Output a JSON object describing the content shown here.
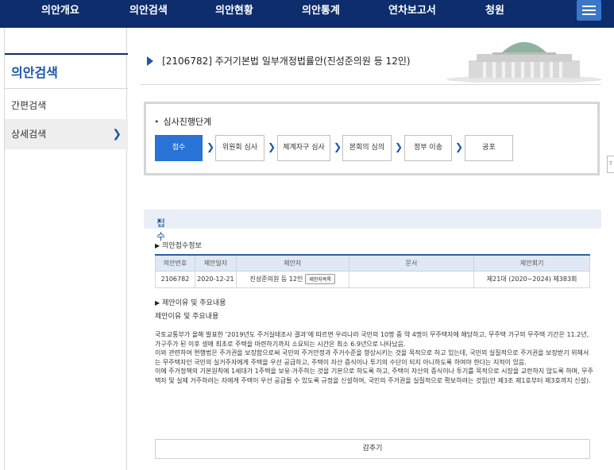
{
  "nav": {
    "items": [
      "의안개요",
      "의안검색",
      "의안현황",
      "의안통계",
      "연차보고서",
      "청원"
    ]
  },
  "sidebar": {
    "title": "의안검색",
    "items": [
      {
        "label": "간편검색"
      },
      {
        "label": "상세검색"
      }
    ]
  },
  "bill": {
    "title": "[2106782] 주거기본법 일부개정법률안(진성준의원 등 12인)"
  },
  "stages": {
    "title": "심사진행단계",
    "steps": [
      "접수",
      "위원회 심사",
      "체계자구 심사",
      "본회의 심의",
      "정부 이송",
      "공포"
    ],
    "active_index": 0
  },
  "section": {
    "title": "접수",
    "receipt_heading": "의안접수정보",
    "table": {
      "headers": [
        "의안번호",
        "제안일자",
        "제안자",
        "문서",
        "제안회기"
      ],
      "row": {
        "bill_no": "2106782",
        "date": "2020-12-21",
        "proposer": "진성준의원 등 12인",
        "proposer_button": "제안자목록",
        "document": "",
        "session": "제21대 (2020~2024) 제383회"
      }
    },
    "reason_heading": "제안이유 및 주요내용",
    "reason_subtitle": "제안이유 및 주요내용",
    "reason_paragraphs": [
      "국토교통부가 올해 발표한 ‘2019년도 주거실태조사 결과’에 따르면 우리나라 국민의 10명 중 약 4명이 무주택자에 해당하고, 무주택 가구의 무주택 기간은 11.2년, 가구주가 된 이후 생애 최초로 주택을 마련하기까지 소요되는 시간은 최소 6.9년으로 나타났음.",
      "이와 관련하여 현행법은 주거권을 보장함으로써 국민의 주거안정과 주거수준을 향상시키는 것을 목적으로 하고 있는데, 국민의 실질적으로 주거권을 보장받기 위해서는 무주택자인 국민의 실거주자에게 주택을 우선 공급하고, 주택이 자산 증식이나 투기의 수단이 되지 아니하도록 하여야 한다는 지적이 있음.",
      "이에 주거정책의 기본원칙에 1세대가 1주택을 보유·거주하는 것을 기본으로 하도록 하고, 주택이 자산의 증식이나 투기를 목적으로 시장을 교란하지 않도록 하며, 무주택자 및 실제 거주하려는 자에게 주택이 우선 공급될 수 있도록 규정을 신설하여, 국민의 주거권을 실질적으로 확보하려는 것임(안 제3조 제1호부터 제3호까지 신설)."
    ],
    "hide_button": "감추기"
  }
}
